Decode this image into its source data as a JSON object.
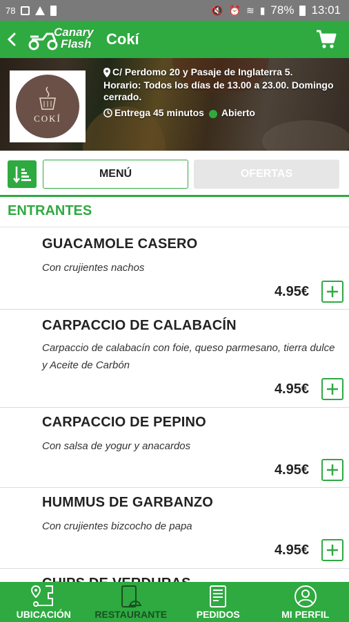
{
  "status_bar": {
    "left_text": "78",
    "battery_percent": "78%",
    "time": "13:01"
  },
  "header": {
    "logo_line1": "Canary",
    "logo_line2": "Flash",
    "title": "Cokí",
    "accent_color": "#2eaa40"
  },
  "restaurant": {
    "logo_text": "COKÍ",
    "address": "C/ Perdomo 20 y Pasaje de Inglaterra 5.",
    "hours": "Horario: Todos los días de 13.00 a 23.00. Domingo cerrado.",
    "delivery": "Entrega 45 minutos",
    "status": "Abierto",
    "status_color": "#2eaa40"
  },
  "tabs": {
    "menu_label": "MENÚ",
    "offers_label": "OFERTAS",
    "active": "MENÚ"
  },
  "section": {
    "title": "ENTRANTES"
  },
  "menu_items": [
    {
      "name": "GUACAMOLE CASERO",
      "description": "Con crujientes nachos",
      "price": "4.95€"
    },
    {
      "name": "CARPACCIO DE CALABACÍN",
      "description": "Carpaccio de calabacín con foie, queso parmesano, tierra dulce y Aceite de Carbón",
      "price": "4.95€"
    },
    {
      "name": "CARPACCIO DE PEPINO",
      "description": "Con salsa de yogur y anacardos",
      "price": "4.95€"
    },
    {
      "name": "HUMMUS DE GARBANZO",
      "description": "Con crujientes bizcocho de papa",
      "price": "4.95€"
    },
    {
      "name": "CHIPS DE VERDURAS",
      "description": "",
      "price": ""
    }
  ],
  "bottom_nav": [
    {
      "label": "UBICACIÓN",
      "icon": "location-map-icon"
    },
    {
      "label": "RESTAURANTE",
      "icon": "restaurant-phone-icon",
      "active": true
    },
    {
      "label": "PEDIDOS",
      "icon": "orders-receipt-icon"
    },
    {
      "label": "MI PERFIL",
      "icon": "profile-user-icon"
    }
  ]
}
